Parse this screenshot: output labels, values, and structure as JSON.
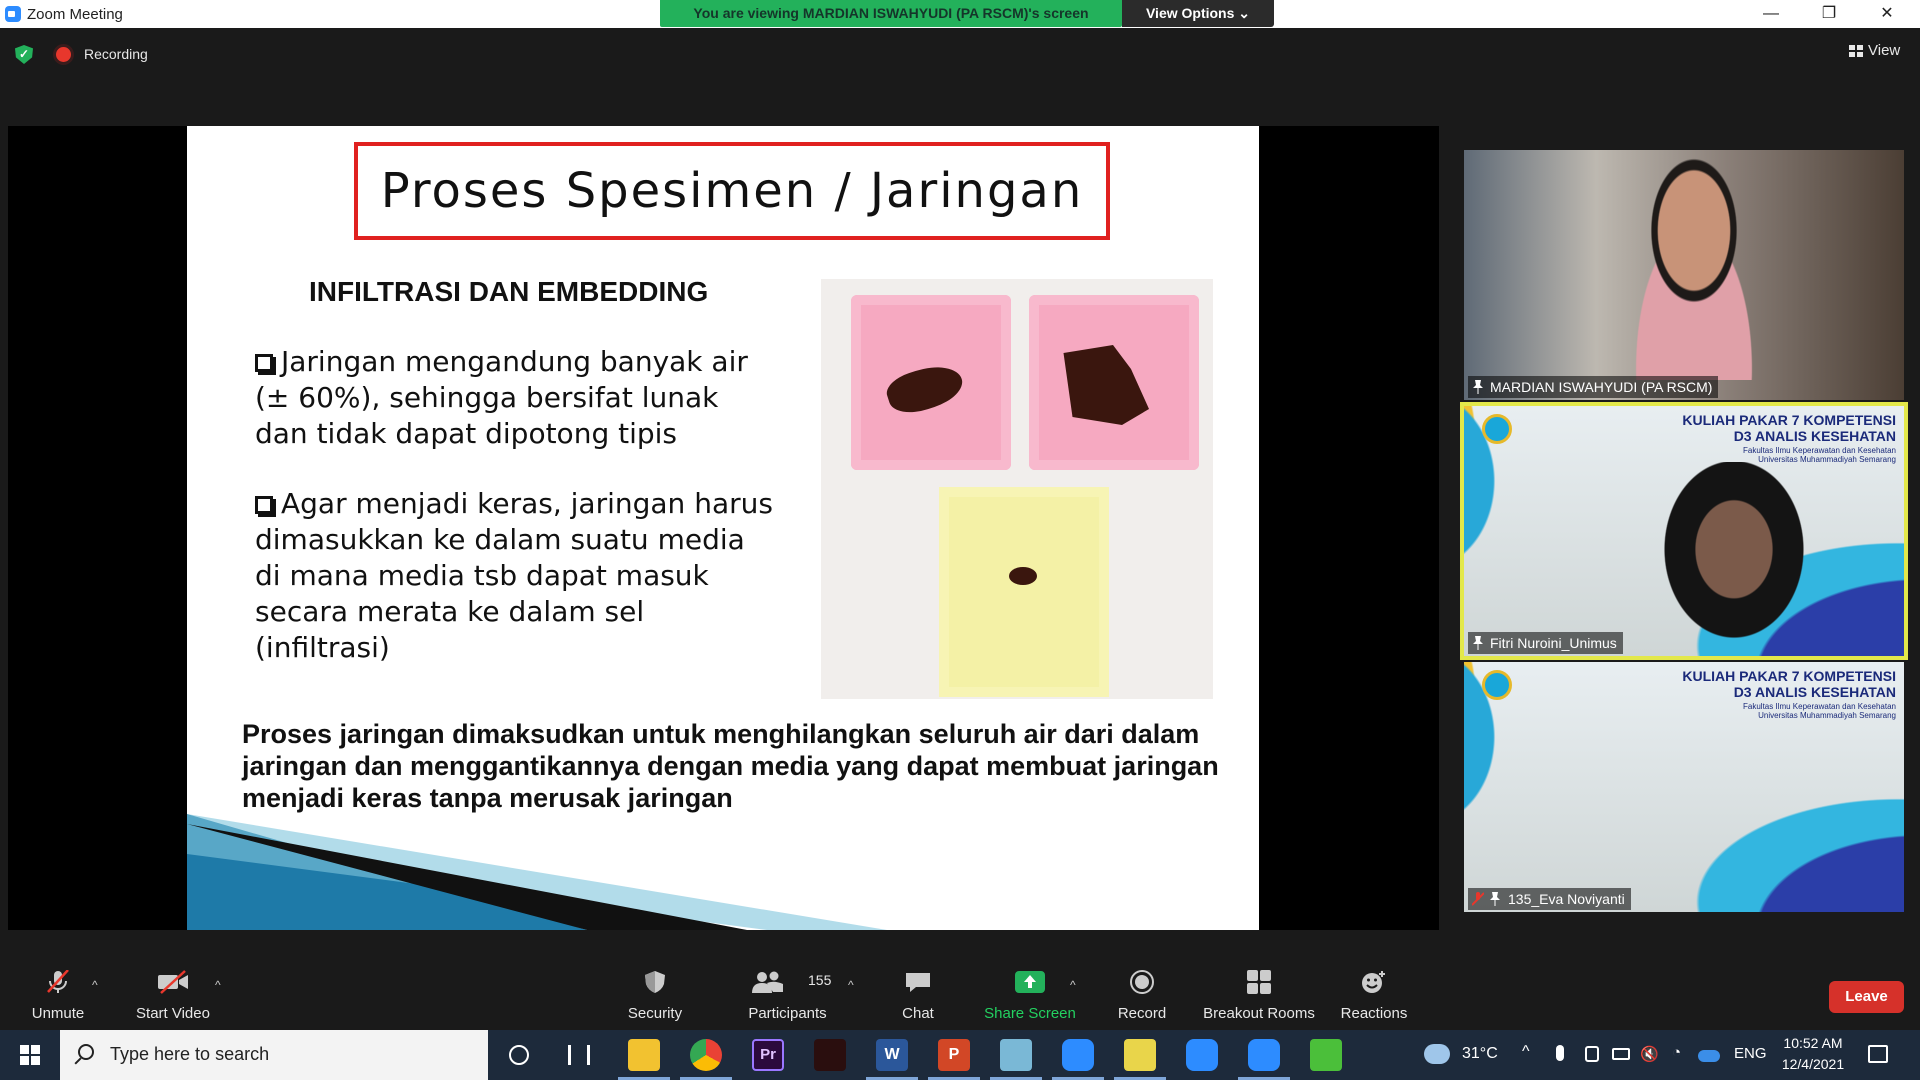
{
  "window": {
    "title": "Zoom Meeting",
    "viewing_banner": "You are viewing MARDIAN ISWAHYUDI (PA RSCM)'s screen",
    "view_options": "View Options ⌄",
    "minimize": "—",
    "restore": "❐",
    "close": "✕"
  },
  "status": {
    "recording_label": "Recording",
    "view_label": "View"
  },
  "slide": {
    "title": "Proses Spesimen / Jaringan",
    "subtitle": "INFILTRASI DAN EMBEDDING",
    "bullets": [
      "Jaringan mengandung banyak air (± 60%), sehingga bersifat lunak dan tidak dapat dipotong tipis",
      "Agar menjadi keras, jaringan harus dimasukkan ke dalam suatu media di mana media tsb dapat masuk secara merata ke dalam sel (infiltrasi)"
    ],
    "conclusion": "Proses jaringan dimaksudkan untuk menghilangkan seluruh air dari dalam jaringan dan menggantikannya dengan media yang dapat membuat jaringan menjadi keras tanpa merusak jaringan"
  },
  "participants": [
    {
      "name": "MARDIAN ISWAHYUDI (PA RSCM)"
    },
    {
      "name": "Fitri Nuroini_Unimus",
      "banner_title": "KULIAH PAKAR 7 KOMPETENSI\nD3 ANALIS KESEHATAN",
      "banner_sub": "Fakultas Ilmu Keperawatan dan Kesehatan\nUniversitas Muhammadiyah Semarang"
    },
    {
      "name": "135_Eva Noviyanti",
      "banner_title": "KULIAH PAKAR 7 KOMPETENSI\nD3 ANALIS KESEHATAN",
      "banner_sub": "Fakultas Ilmu Keperawatan dan Kesehatan\nUniversitas Muhammadiyah Semarang"
    }
  ],
  "toolbar": {
    "unmute": "Unmute",
    "start_video": "Start Video",
    "security": "Security",
    "participants": "Participants",
    "participants_count": "155",
    "chat": "Chat",
    "share_screen": "Share Screen",
    "record": "Record",
    "breakout_rooms": "Breakout Rooms",
    "reactions": "Reactions",
    "leave": "Leave"
  },
  "taskbar": {
    "search_placeholder": "Type here to search",
    "temperature": "31°C",
    "language": "ENG",
    "time": "10:52 AM",
    "date": "12/4/2021"
  },
  "colors": {
    "accent_green": "#23b15b",
    "leave_red": "#d6312a",
    "active_speaker": "#e3e84a",
    "slide_title_border": "#e0211f"
  }
}
